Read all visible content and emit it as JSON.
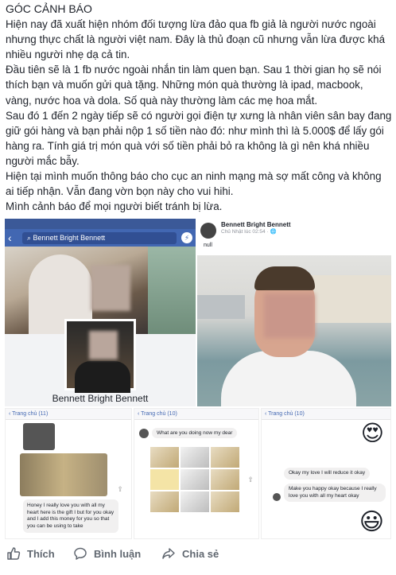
{
  "post": {
    "title": "GÓC CẢNH BÁO",
    "paragraphs": [
      "Hiện nay đã xuất hiện nhóm đối tượng lừa đảo qua fb giả là người nước ngoài nhưng thực chất là người việt nam. Đây là thủ đoạn cũ nhưng vẫn lừa được khá nhiều người nhẹ dạ cả tin.",
      "Đầu tiên sẽ là 1 fb nước ngoài nhắn tin làm quen bạn. Sau 1 thời gian họ sẽ nói thích bạn và muốn gửi quà tặng. Những món quà thường là ipad, macbook, vàng, nước hoa và dola. Số quà này thường làm các mẹ hoa mắt.",
      "Sau đó 1 đến 2 ngày tiếp sẽ có người gọi điện tự xưng là nhân viên sân bay đang giữ gói hàng và bạn phải nộp 1 số tiền nào đó: như mình thì là 5.000$ để lấy gói hàng ra. Tính giá trị món quà với số tiền phải bỏ ra không là gì nên khá nhiều người mắc bẫy.",
      "Hiện tại mình muốn thông báo cho cục an ninh mạng mà sợ mất công và không ai tiếp nhận. Vẫn đang vờn bọn này cho vui hihi.",
      "Mình cảnh báo để mọi người biết tránh bị lừa."
    ]
  },
  "photo1": {
    "search_text": "Bennett Bright Bennett",
    "profile_name": "Bennett Bright Bennett"
  },
  "photo2": {
    "poster_name": "Bennett Bright Bennett",
    "poster_time": "Chủ Nhật lúc 02:54 · ",
    "caption": "null"
  },
  "chat1": {
    "back": "‹ Trang chủ (11)",
    "message": "Honey I really love you with all my heart here is the gift I but for you okay and I add this money for you so that you can be using to take"
  },
  "chat2": {
    "back": "‹ Trang chủ (10)",
    "message": "What are you doing now my dear"
  },
  "chat3": {
    "back": "‹ Trang chủ (10)",
    "message1": "Okay my love I will reduce it okay",
    "message2": "Make you happy okay because I really love you with all my heart okay"
  },
  "actions": {
    "like": "Thích",
    "comment": "Bình luận",
    "share": "Chia sẻ"
  },
  "colors": {
    "facebook_blue": "#4267b2",
    "action_gray": "#606770"
  }
}
